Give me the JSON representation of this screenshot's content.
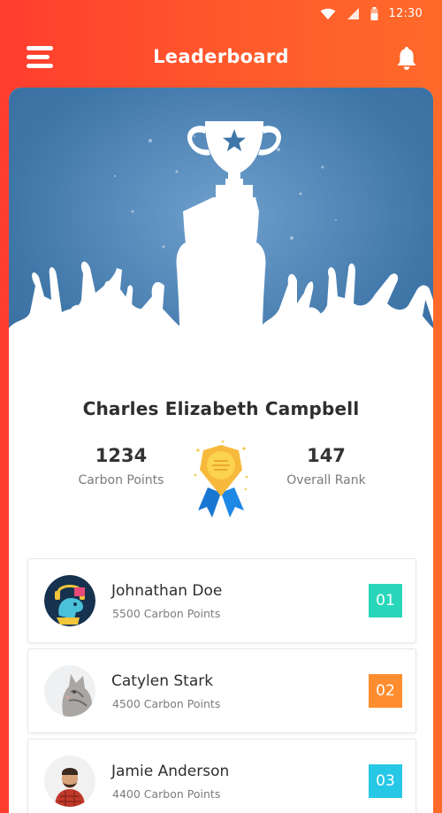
{
  "status_bar": {
    "time": "12:30"
  },
  "app_bar": {
    "title": "Leaderboard"
  },
  "profile": {
    "name": "Charles Elizabeth Campbell",
    "carbon_points": "1234",
    "carbon_points_label": "Carbon Points",
    "overall_rank": "147",
    "overall_rank_label": "Overall Rank"
  },
  "leaderboard": [
    {
      "name": "Johnathan Doe",
      "points": "5500 Carbon Points",
      "rank": "01",
      "rank_color": "#2ad6b9",
      "avatar": "dinosaur-avatar"
    },
    {
      "name": "Catylen Stark",
      "points": "4500 Carbon Points",
      "rank": "02",
      "rank_color": "#ff8d2f",
      "avatar": "cat-avatar"
    },
    {
      "name": "Jamie Anderson",
      "points": "4400 Carbon Points",
      "rank": "03",
      "rank_color": "#27c7e6",
      "avatar": "man-avatar"
    }
  ],
  "colors": {
    "header_gradient_start": "#ff3d2e",
    "header_gradient_end": "#ff6a2a",
    "hero_blue": "#3f76a8"
  }
}
